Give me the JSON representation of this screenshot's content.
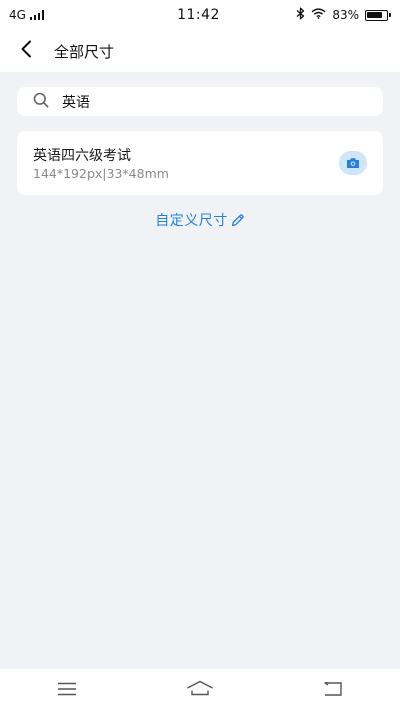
{
  "status_bar": {
    "network": "4G",
    "time": "11:42",
    "battery_text": "83%",
    "battery_level": 0.83,
    "icons": [
      "signal-icon",
      "bluetooth-icon",
      "wifi-icon",
      "battery-icon"
    ]
  },
  "header": {
    "title": "全部尺寸",
    "back_icon": "chevron-left-icon"
  },
  "search": {
    "value": "英语",
    "placeholder": "",
    "icon": "search-icon"
  },
  "results": [
    {
      "name": "英语四六级考试",
      "spec": "144*192px|33*48mm",
      "action_icon": "camera-icon"
    }
  ],
  "custom_size": {
    "label": "自定义尺寸",
    "icon": "pencil-icon"
  },
  "nav": {
    "icons": [
      "menu-icon",
      "home-icon",
      "back-icon"
    ]
  },
  "colors": {
    "accent": "#2680d8",
    "background": "#f1f2f6",
    "camera_bg": "#cfe6f8"
  }
}
